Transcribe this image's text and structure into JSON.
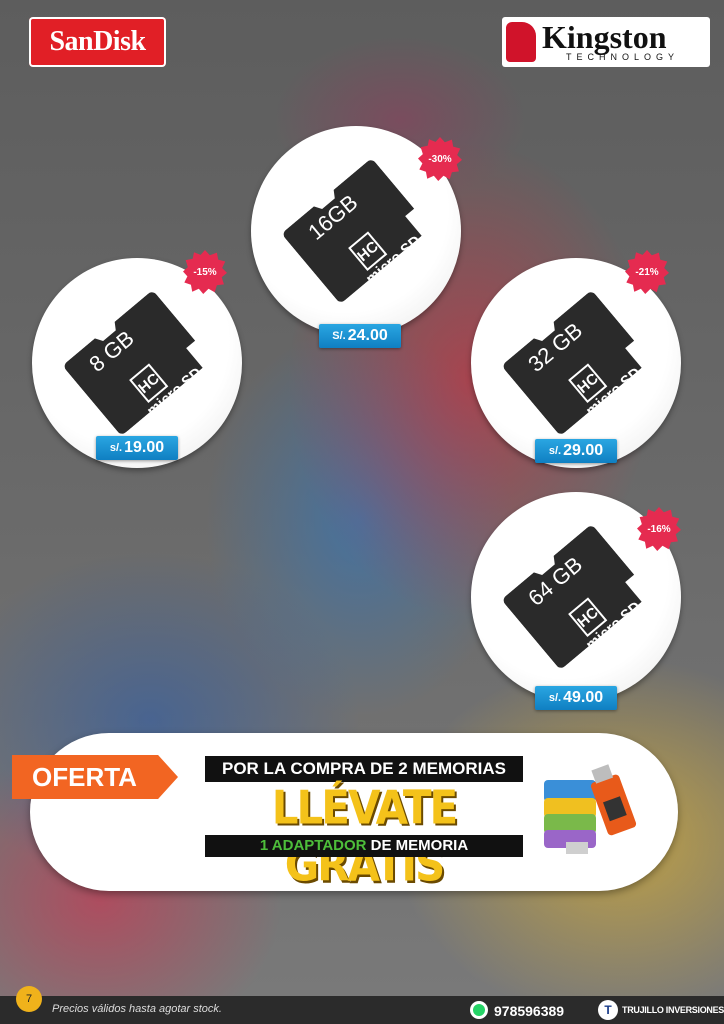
{
  "logos": {
    "sandisk": "SanDisk",
    "kingston": "Kingston",
    "kingston_sub": "TECHNOLOGY"
  },
  "products": [
    {
      "brand": "micro SD",
      "hc": "HC",
      "capacity": "8 GB",
      "discount": "-15%",
      "currency": "s/.",
      "price": "19.00"
    },
    {
      "brand": "micro SD",
      "hc": "HC",
      "capacity": "16GB",
      "discount": "-30%",
      "currency": "S/.",
      "price": "24.00"
    },
    {
      "brand": "micro SD",
      "hc": "HC",
      "capacity": "32 GB",
      "discount": "-21%",
      "currency": "s/.",
      "price": "29.00"
    },
    {
      "brand": "micro SD",
      "hc": "HC",
      "capacity": "64 GB",
      "discount": "-16%",
      "currency": "s/.",
      "price": "49.00"
    }
  ],
  "offer": {
    "tag": "OFERTA",
    "line1": "POR  LA COMPRA DE 2 MEMORIAS",
    "headline": "LLÉVATE GRATIS",
    "line2_highlight": "1 ADAPTADOR",
    "line2_rest": " DE MEMORIA"
  },
  "footer": {
    "page": "7",
    "note": "Precios válidos hasta agotar stock.",
    "phone": "978596389",
    "company": "TRUJILLO INVERSIONES",
    "company_mark": "T"
  }
}
